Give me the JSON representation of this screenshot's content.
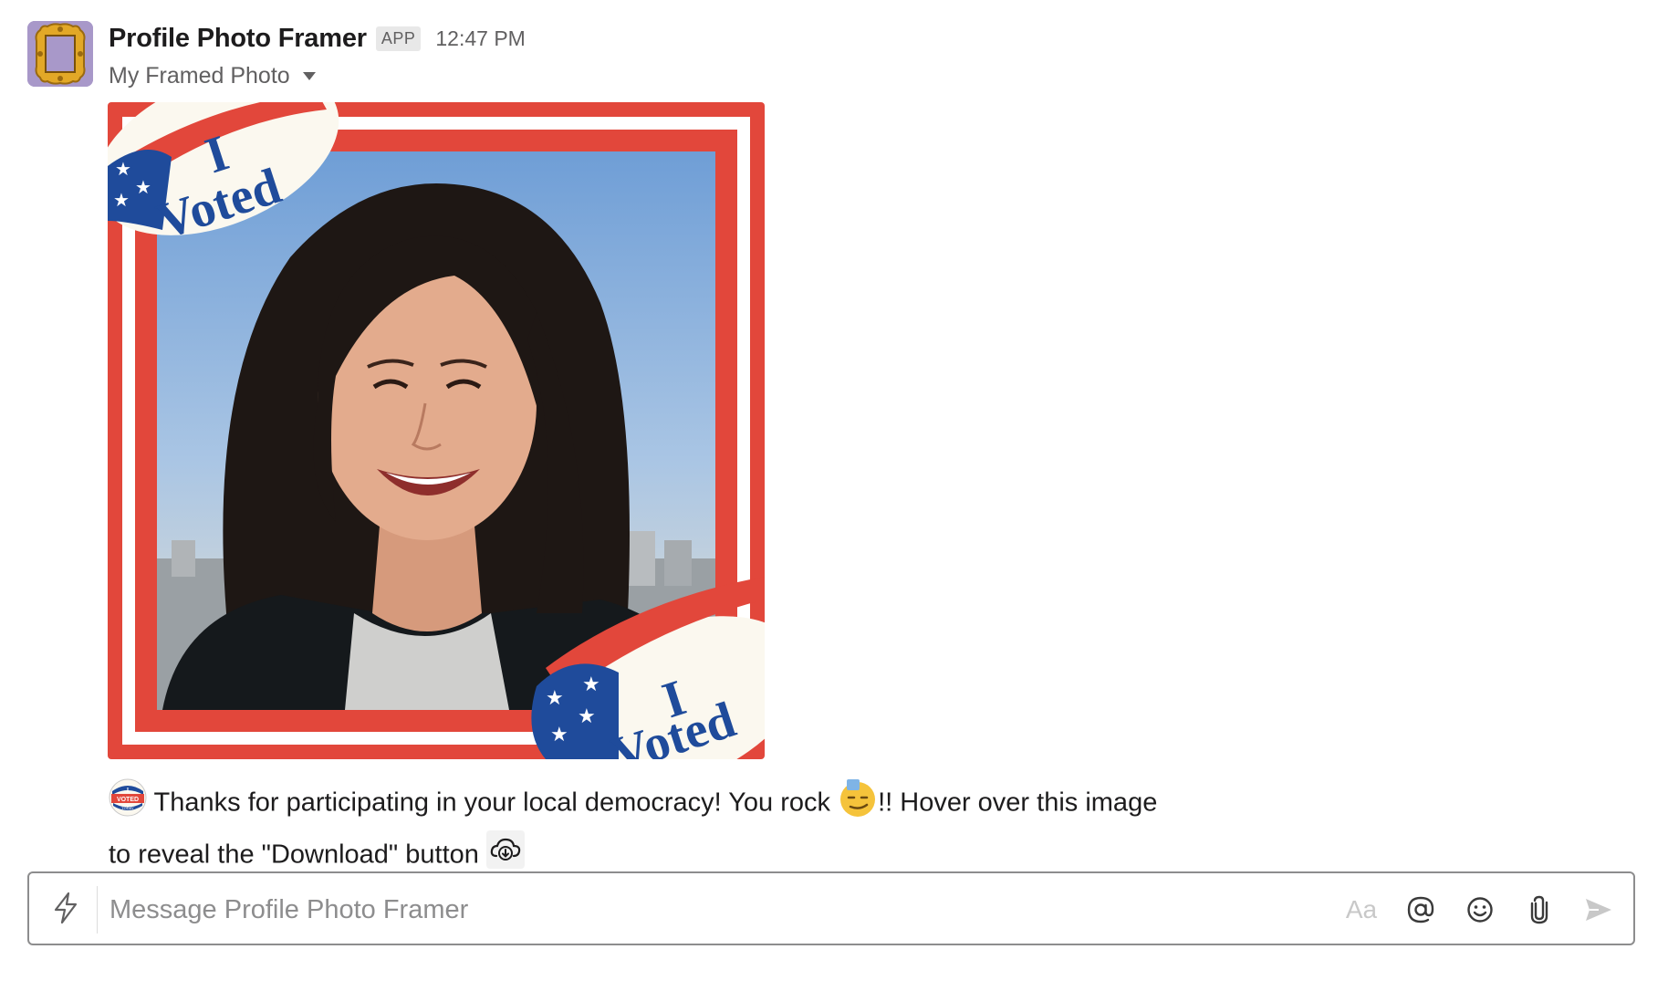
{
  "message": {
    "sender": "Profile Photo Framer",
    "badge": "APP",
    "timestamp": "12:47 PM",
    "attachment_title": "My Framed Photo",
    "image": {
      "sticker_line1": "I",
      "sticker_line2": "Voted",
      "frame_colors": {
        "red": "#e2473b",
        "white": "#ffffff",
        "blue": "#1f4b9b",
        "cream": "#fbf8ef"
      }
    },
    "text_part1": "Thanks for participating in your local democracy! You rock",
    "text_part2": "!! Hover over this image",
    "text_part3": "to reveal the \"Download\" button",
    "emoji_sticker_top": "I",
    "emoji_sticker_mid": "VOTED",
    "emoji_sticker_bottom": "TODAY"
  },
  "composer": {
    "placeholder": "Message Profile Photo Framer",
    "format_label": "Aa"
  },
  "icons": [
    "picture-frame-icon",
    "caret-down-icon",
    "i-voted-sticker-icon",
    "smirk-emoji-icon",
    "cloud-download-icon",
    "lightning-bolt-icon",
    "mention-icon",
    "emoji-icon",
    "paperclip-icon",
    "send-icon"
  ]
}
